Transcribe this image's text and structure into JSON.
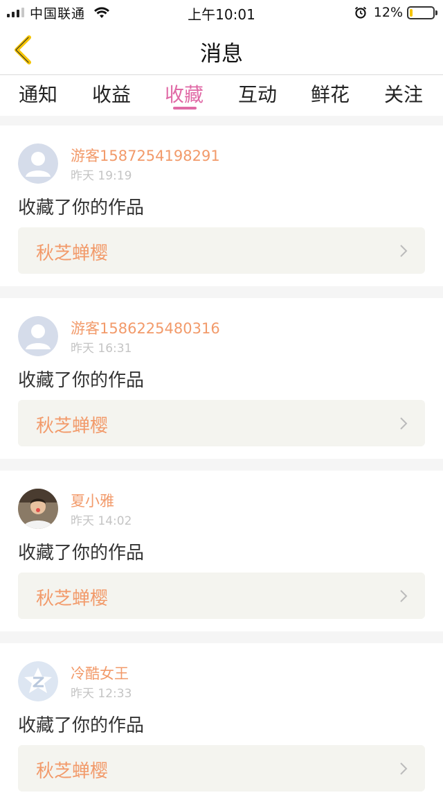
{
  "status_bar": {
    "carrier": "中国联通",
    "time": "上午10:01",
    "battery_percent": "12%",
    "battery_level": 0.12,
    "battery_color": "#f5c400"
  },
  "nav": {
    "title": "消息",
    "back_icon": "back-chevron-icon"
  },
  "tabs": [
    {
      "label": "通知"
    },
    {
      "label": "收益"
    },
    {
      "label": "收藏"
    },
    {
      "label": "互动"
    },
    {
      "label": "鲜花"
    },
    {
      "label": "关注"
    }
  ],
  "active_tab_index": 2,
  "colors": {
    "accent_pink": "#e06aa6",
    "name_orange": "#f29a6a",
    "work_box_bg": "#f4f4ef"
  },
  "messages": [
    {
      "username": "游客1587254198291",
      "time": "昨天 19:19",
      "action": "收藏了你的作品",
      "work_title": "秋芝蝉樱",
      "avatar": "default-avatar-icon"
    },
    {
      "username": "游客1586225480316",
      "time": "昨天 16:31",
      "action": "收藏了你的作品",
      "work_title": "秋芝蝉樱",
      "avatar": "default-avatar-icon"
    },
    {
      "username": "夏小雅",
      "time": "昨天 14:02",
      "action": "收藏了你的作品",
      "work_title": "秋芝蝉樱",
      "avatar": "user-photo-avatar"
    },
    {
      "username": "冷酷女王",
      "time": "昨天 12:33",
      "action": "收藏了你的作品",
      "work_title": "秋芝蝉樱",
      "avatar": "qq-star-avatar-icon"
    }
  ]
}
